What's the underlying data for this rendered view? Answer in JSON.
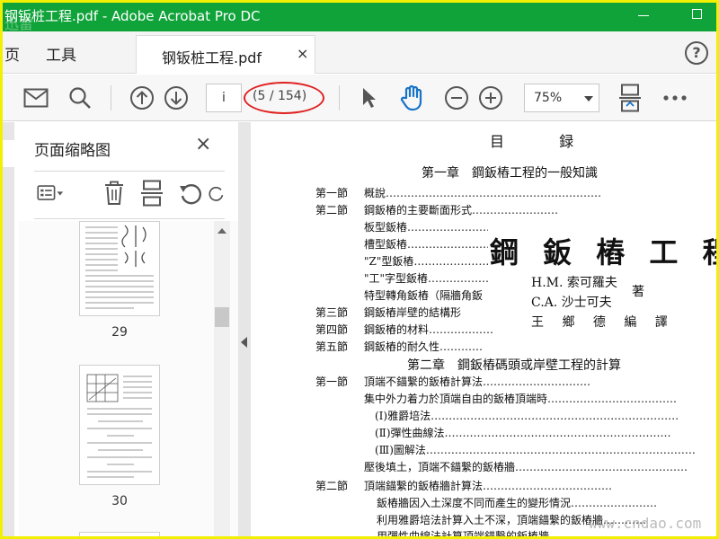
{
  "window": {
    "title": "钢钣桩工程.pdf - Adobe Acrobat Pro DC",
    "logo_watermark": "迅雷"
  },
  "menu": {
    "items": [
      "页",
      "工具"
    ],
    "tab_label": "钢钣桩工程.pdf",
    "tab_close": "×",
    "help": "?"
  },
  "toolbar": {
    "page_input": "i",
    "page_count": "(5 / 154)",
    "zoom": "75%",
    "icons": [
      "mail-icon",
      "search-icon",
      "arrow-up-icon",
      "arrow-down-icon",
      "pointer-icon",
      "hand-icon",
      "zoom-out-icon",
      "zoom-in-icon",
      "fit-page-icon",
      "more-icon"
    ]
  },
  "panel": {
    "title": "页面缩略图",
    "close": "×",
    "thumbnails": [
      {
        "label": "29"
      },
      {
        "label": "30"
      }
    ]
  },
  "document": {
    "heading": "目 録",
    "chapter1": "第一章　鋼鈑樁工程的一般知識",
    "chapter2": "第二章　鋼鈑樁碼頭或岸壁工程的計算",
    "sections": [
      {
        "num": "第一節",
        "text": "概說……………………………………………………"
      },
      {
        "num": "第二節",
        "text": "鋼鈑樁的主要斷面形式……………………"
      },
      {
        "num": "",
        "text": "板型鈑樁……………………………………"
      },
      {
        "num": "",
        "text": "槽型鈑樁……………………………………"
      },
      {
        "num": "",
        "text": "\"Z\"型鈑樁……………………………………"
      },
      {
        "num": "",
        "text": "\"工\"字型鈑樁…………………………………"
      },
      {
        "num": "",
        "text": "特型轉角鈑樁（隔牆角鈑"
      },
      {
        "num": "第三節",
        "text": "鋼鈑樁岸壁的結構形"
      },
      {
        "num": "第四節",
        "text": "鋼鈑樁的材料………………"
      },
      {
        "num": "第五節",
        "text": "鋼鈑樁的耐久性…………"
      }
    ],
    "sections2": [
      {
        "num": "第一節",
        "text": "頂端不錨繫的鈑樁計算法…………………………"
      },
      {
        "num": "",
        "text": "集中外力着力於頂端自由的鈑樁頂端時………………………………"
      },
      {
        "num": "",
        "text": "(Ⅰ)雅爵培法……………………………………………………………"
      },
      {
        "num": "",
        "text": "(Ⅱ)彈性曲線法………………………………………………………"
      },
      {
        "num": "",
        "text": "(Ⅲ)圖解法…………………………………………………………………"
      },
      {
        "num": "",
        "text": "壓後填土，頂端不錨繫的鈑樁牆…………………………………………"
      },
      {
        "num": "第二節",
        "text": "頂端錨繫的鈑樁牆計算法………………………………"
      },
      {
        "num": "",
        "text": "鈑樁牆因入土深度不同而產生的變形情況……………………"
      },
      {
        "num": "",
        "text": "利用雅爵培法計算入土不深，頂端錨繫的鈑樁牆…………"
      },
      {
        "num": "",
        "text": "用彈性曲線法計算頂端錨繫的鈑樁牆……………"
      }
    ],
    "book_title": "鋼 鈑 樁 工 程",
    "author1": "H.M. 索可羅夫",
    "author2": "C.A. 沙士可夫",
    "author_mark": "著",
    "translator": "王 鄉 德 編 譯",
    "site_watermark": "www.cndao.com"
  },
  "colors": {
    "title_bar": "#10a33a",
    "outer_border": "#f2f002",
    "annotation_red": "#e02020"
  }
}
